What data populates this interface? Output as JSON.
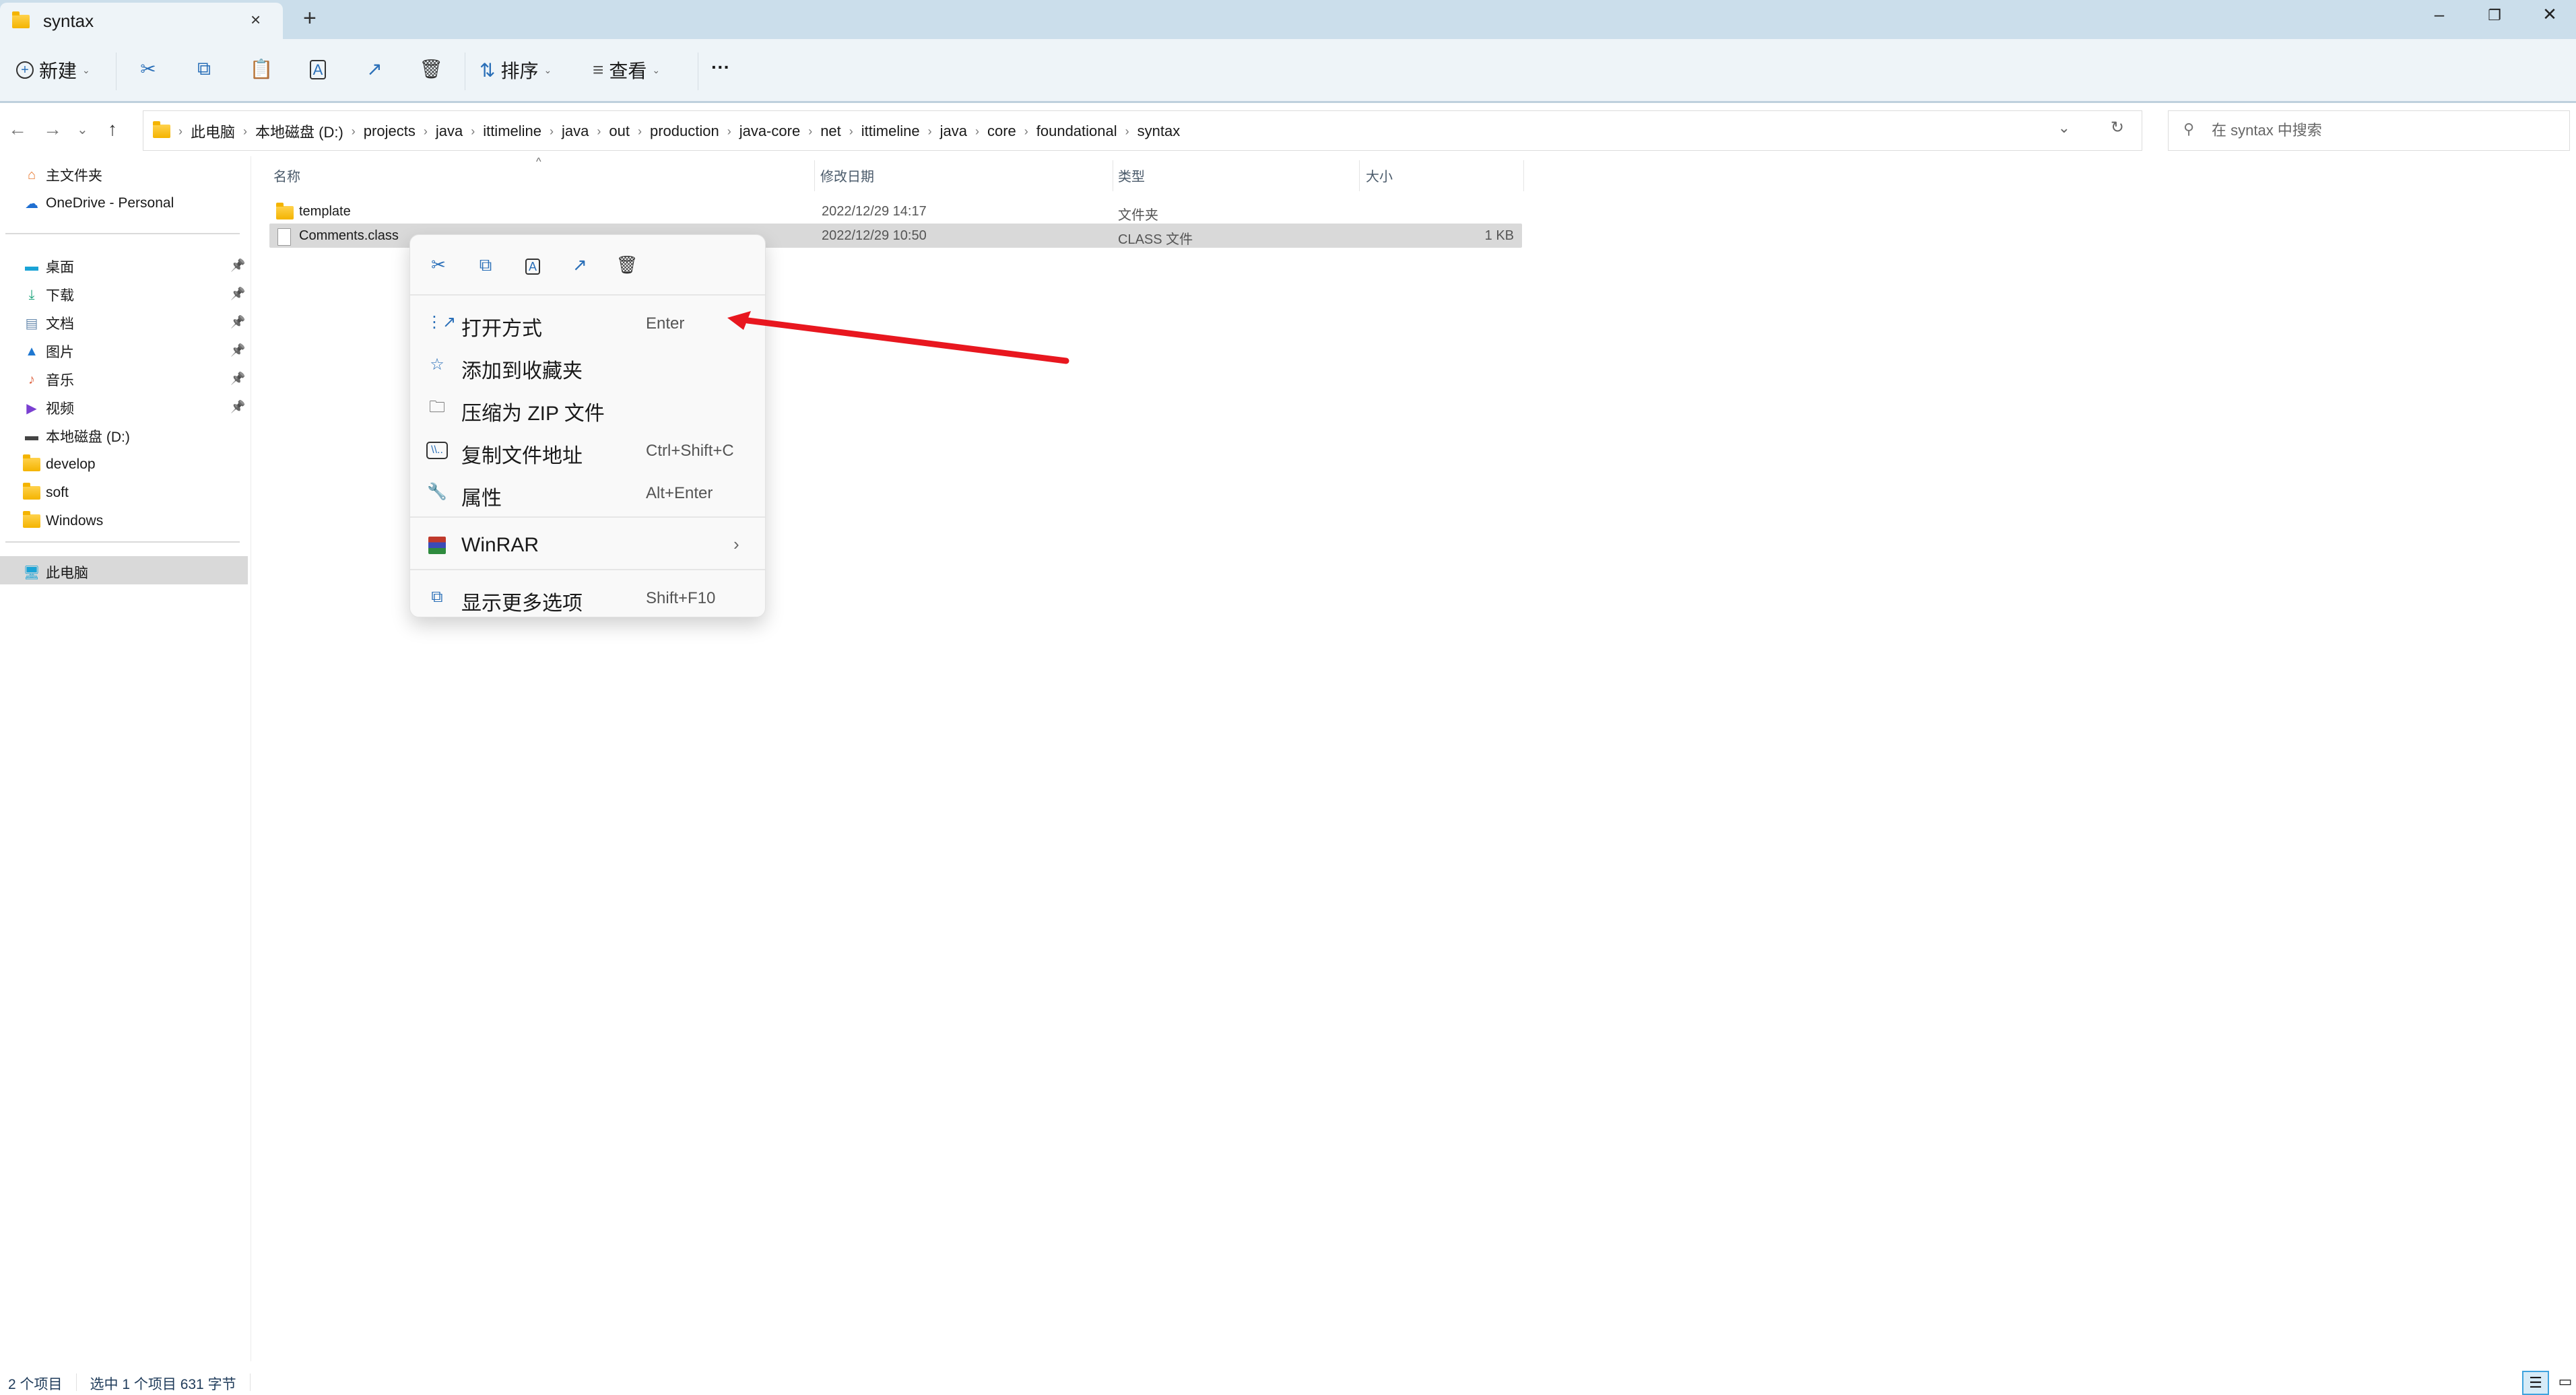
{
  "window": {
    "tab_title": "syntax",
    "tab_close": "×",
    "new_tab": "+",
    "minimize": "–",
    "restore": "❐",
    "close": "✕"
  },
  "toolbar": {
    "new_label": "新建",
    "new_icon": "plus-circle-icon",
    "cut_icon": "scissors-icon",
    "copy_icon": "copy-icon",
    "paste_icon": "paste-icon",
    "rename_icon": "rename-icon",
    "share_icon": "share-icon",
    "delete_icon": "trash-icon",
    "sort_label": "排序",
    "view_label": "查看",
    "more_label": "···"
  },
  "address": {
    "breadcrumbs": [
      "此电脑",
      "本地磁盘 (D:)",
      "projects",
      "java",
      "ittimeline",
      "java",
      "out",
      "production",
      "java-core",
      "net",
      "ittimeline",
      "java",
      "core",
      "foundational",
      "syntax"
    ],
    "search_placeholder": "在 syntax 中搜索"
  },
  "sidebar": {
    "items": [
      {
        "label": "主文件夹",
        "icon": "home-icon",
        "pinned": false
      },
      {
        "label": "OneDrive - Personal",
        "icon": "onedrive-icon",
        "pinned": false
      },
      {
        "label": "桌面",
        "icon": "desktop-icon",
        "pinned": true
      },
      {
        "label": "下载",
        "icon": "download-icon",
        "pinned": true
      },
      {
        "label": "文档",
        "icon": "documents-icon",
        "pinned": true
      },
      {
        "label": "图片",
        "icon": "pictures-icon",
        "pinned": true
      },
      {
        "label": "音乐",
        "icon": "music-icon",
        "pinned": true
      },
      {
        "label": "视频",
        "icon": "videos-icon",
        "pinned": true
      },
      {
        "label": "本地磁盘 (D:)",
        "icon": "drive-icon",
        "pinned": false
      },
      {
        "label": "develop",
        "icon": "folder-icon",
        "pinned": false
      },
      {
        "label": "soft",
        "icon": "folder-icon",
        "pinned": false
      },
      {
        "label": "Windows",
        "icon": "folder-icon",
        "pinned": false
      },
      {
        "label": "此电脑",
        "icon": "computer-icon",
        "pinned": false,
        "selected": true
      }
    ]
  },
  "files": {
    "columns": [
      "名称",
      "修改日期",
      "类型",
      "大小"
    ],
    "rows": [
      {
        "name": "template",
        "modified": "2022/12/29 14:17",
        "type": "文件夹",
        "size": "",
        "selected": false
      },
      {
        "name": "Comments.class",
        "modified": "2022/12/29 10:50",
        "type": "CLASS 文件",
        "size": "1 KB",
        "selected": true
      }
    ]
  },
  "context_menu": {
    "quick_actions": [
      "cut",
      "copy",
      "rename",
      "share",
      "delete"
    ],
    "items": [
      {
        "label": "打开方式",
        "shortcut": "Enter",
        "icon": "open-with-icon"
      },
      {
        "label": "添加到收藏夹",
        "shortcut": "",
        "icon": "star-icon"
      },
      {
        "label": "压缩为 ZIP 文件",
        "shortcut": "",
        "icon": "zip-icon"
      },
      {
        "label": "复制文件地址",
        "shortcut": "Ctrl+Shift+C",
        "icon": "copy-path-icon"
      },
      {
        "label": "属性",
        "shortcut": "Alt+Enter",
        "icon": "wrench-icon"
      },
      {
        "label": "WinRAR",
        "shortcut": "",
        "icon": "winrar-icon",
        "submenu": true
      },
      {
        "label": "显示更多选项",
        "shortcut": "Shift+F10",
        "icon": "more-options-icon"
      }
    ]
  },
  "annotation": {
    "type": "arrow",
    "color": "#e8171f",
    "points_to": "打开方式"
  },
  "status": {
    "item_count": "2 个项目",
    "selection": "选中 1 个项目  631 字节"
  }
}
